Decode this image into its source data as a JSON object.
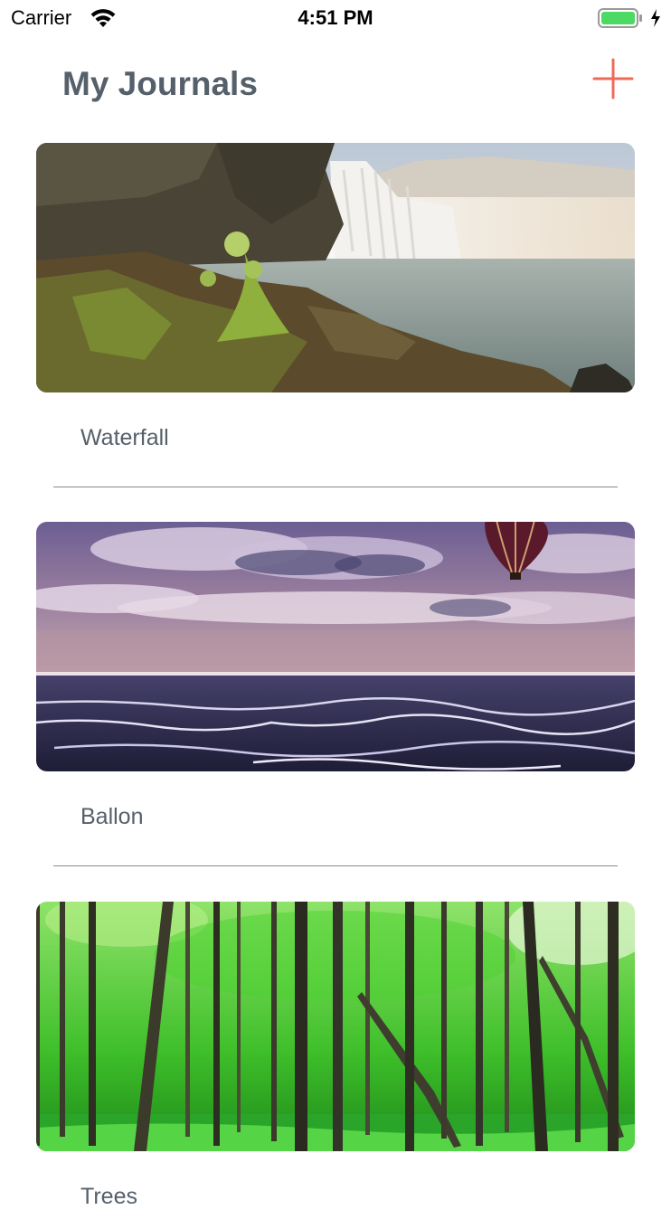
{
  "status_bar": {
    "carrier": "Carrier",
    "time": "4:51 PM",
    "battery_color": "#4cd964"
  },
  "header": {
    "title": "My Journals",
    "add_icon": "plus-icon",
    "accent_color": "#f06a5a"
  },
  "journals": [
    {
      "title": "Waterfall",
      "image": "waterfall-photo"
    },
    {
      "title": "Ballon",
      "image": "balloon-photo"
    },
    {
      "title": "Trees",
      "image": "forest-photo"
    }
  ]
}
